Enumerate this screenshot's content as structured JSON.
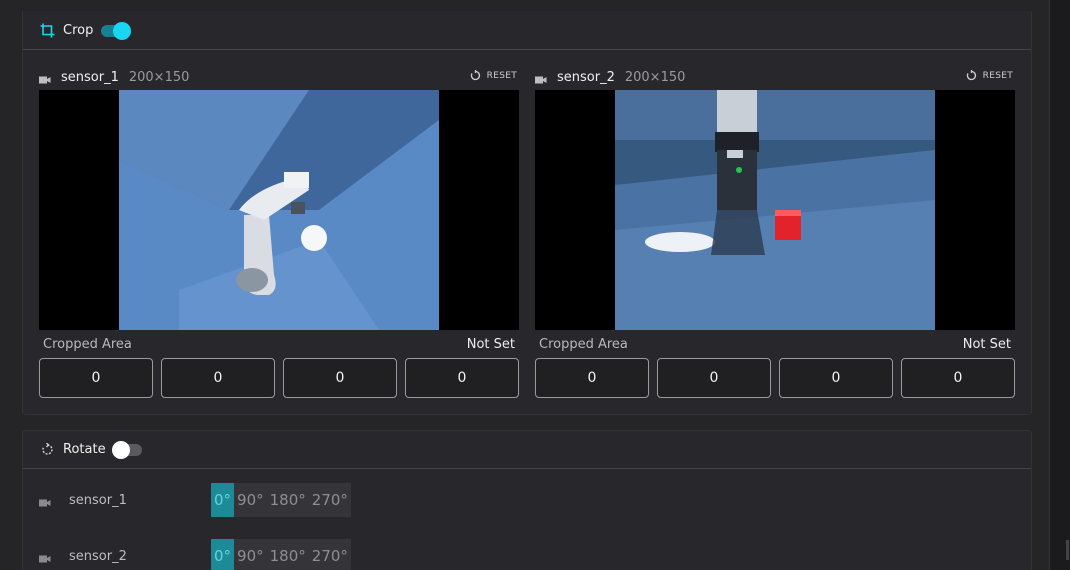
{
  "crop": {
    "title": "Crop",
    "enabled": true,
    "sensors": [
      {
        "name": "sensor_1",
        "dims": "200×150",
        "reset_label": "RESET",
        "cropped_area_label": "Cropped Area",
        "status": "Not Set",
        "values": [
          "0",
          "0",
          "0",
          "0"
        ]
      },
      {
        "name": "sensor_2",
        "dims": "200×150",
        "reset_label": "RESET",
        "cropped_area_label": "Cropped Area",
        "status": "Not Set",
        "values": [
          "0",
          "0",
          "0",
          "0"
        ]
      }
    ]
  },
  "rotate": {
    "title": "Rotate",
    "enabled": false,
    "options": [
      "0°",
      "90°",
      "180°",
      "270°"
    ],
    "sensors": [
      {
        "name": "sensor_1",
        "selected": "0°"
      },
      {
        "name": "sensor_2",
        "selected": "0°"
      }
    ]
  },
  "colors": {
    "accent": "#19d6f2",
    "selected_segment": "#1e8a97"
  },
  "icons": {
    "crop": "crop-icon",
    "rotate": "rotate-icon",
    "camera": "video-camera-icon",
    "reset": "reset-icon"
  }
}
